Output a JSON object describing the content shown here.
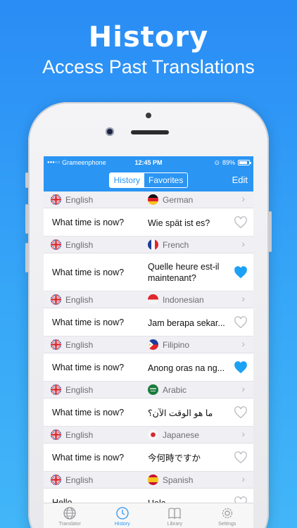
{
  "promo": {
    "title": "History",
    "subtitle": "Access Past Translations"
  },
  "status": {
    "carrier": "Grameenphone",
    "time": "12:45 PM",
    "battery": "89%"
  },
  "nav": {
    "history": "History",
    "favorites": "Favorites",
    "edit": "Edit"
  },
  "entries": [
    {
      "src_lang": "English",
      "dst_lang": "German",
      "src_text": "What time is now?",
      "dst_text": "Wie spät ist es?",
      "favorite": false
    },
    {
      "src_lang": "English",
      "dst_lang": "French",
      "src_text": "What time is now?",
      "dst_text": "Quelle heure est-il maintenant?",
      "favorite": true
    },
    {
      "src_lang": "English",
      "dst_lang": "Indonesian",
      "src_text": "What time is now?",
      "dst_text": "Jam berapa sekar...",
      "favorite": false
    },
    {
      "src_lang": "English",
      "dst_lang": "Filipino",
      "src_text": "What time is now?",
      "dst_text": "Anong oras na ng...",
      "favorite": true
    },
    {
      "src_lang": "English",
      "dst_lang": "Arabic",
      "src_text": "What time is now?",
      "dst_text": "ما هو الوقت الآن؟",
      "favorite": false
    },
    {
      "src_lang": "English",
      "dst_lang": "Japanese",
      "src_text": "What time is now?",
      "dst_text": "今何時ですか",
      "favorite": false
    },
    {
      "src_lang": "English",
      "dst_lang": "Spanish",
      "src_text": "Hello",
      "dst_text": "Hola",
      "favorite": false
    }
  ],
  "tabs": {
    "translator": "Translator",
    "history": "History",
    "library": "Library",
    "settings": "Settings"
  },
  "colors": {
    "accent": "#2b95f3",
    "heart_active": "#1da1f5"
  }
}
